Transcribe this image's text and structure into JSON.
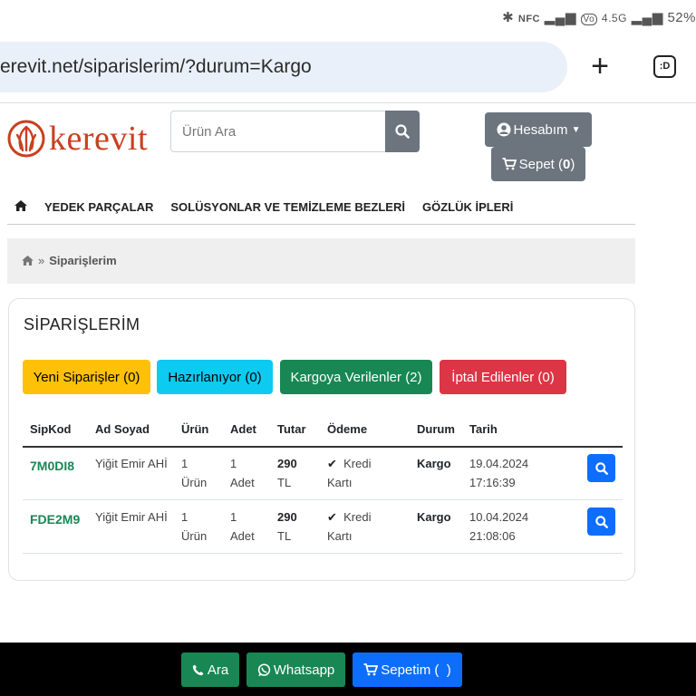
{
  "status_bar": {
    "icons": [
      "bluetooth-icon",
      "nfc-icon",
      "signal-icon",
      "volte-icon",
      "4g-icon",
      "signal-icon"
    ],
    "text_nfc": "NFC",
    "text_net": "4.5G",
    "battery": "52%"
  },
  "browser": {
    "url": "erevit.net/siparislerim/?durum=Kargo",
    "tab_count": ":D"
  },
  "header": {
    "logo_text": "kerevit",
    "search_placeholder": "Ürün Ara",
    "account_label": "Hesabım",
    "cart_label": "Sepet",
    "cart_count": "0"
  },
  "nav": {
    "items": [
      "YEDEK PARÇALAR",
      "SOLÜSYONLAR VE TEMİZLEME BEZLERİ",
      "GÖZLÜK İPLERİ"
    ]
  },
  "breadcrumb": {
    "separator": "»",
    "current": "Siparişlerim"
  },
  "orders": {
    "title": "SİPARİŞLERİM",
    "status_buttons": [
      {
        "label": "Yeni Siparişler (0)",
        "color": "#ffc107"
      },
      {
        "label": "Hazırlanıyor (0)",
        "color": "#0dcaf0"
      },
      {
        "label": "Kargoya Verilenler (2)",
        "color": "#198754"
      },
      {
        "label": "İptal Edilenler (0)",
        "color": "#dc3545"
      }
    ],
    "columns": [
      "SipKod",
      "Ad Soyad",
      "Ürün",
      "Adet",
      "Tutar",
      "Ödeme",
      "Durum",
      "Tarih"
    ],
    "rows": [
      {
        "sipkod": "7M0DI8",
        "ad_soyad": "Yiğit Emir AHİ",
        "urun_1": "1",
        "urun_2": "Ürün",
        "adet_1": "1",
        "adet_2": "Adet",
        "tutar_1": "290",
        "tutar_2": "TL",
        "odeme_1": "Kredi",
        "odeme_2": "Kartı",
        "durum": "Kargo",
        "tarih_1": "19.04.2024",
        "tarih_2": "17:16:39"
      },
      {
        "sipkod": "FDE2M9",
        "ad_soyad": "Yiğit Emir AHİ",
        "urun_1": "1",
        "urun_2": "Ürün",
        "adet_1": "1",
        "adet_2": "Adet",
        "tutar_1": "290",
        "tutar_2": "TL",
        "odeme_1": "Kredi",
        "odeme_2": "Kartı",
        "durum": "Kargo",
        "tarih_1": "10.04.2024",
        "tarih_2": "21:08:06"
      }
    ]
  },
  "bottom_bar": {
    "call_label": "Ara",
    "whatsapp_label": "Whatsapp",
    "cart_label": "Sepetim (  )",
    "call_color": "#198754",
    "whatsapp_color": "#198754",
    "cart_color": "#0d6efd"
  },
  "colors": {
    "brand": "#c9401f",
    "success": "#198754",
    "primary": "#0d6efd",
    "secondary": "#6c757d"
  }
}
